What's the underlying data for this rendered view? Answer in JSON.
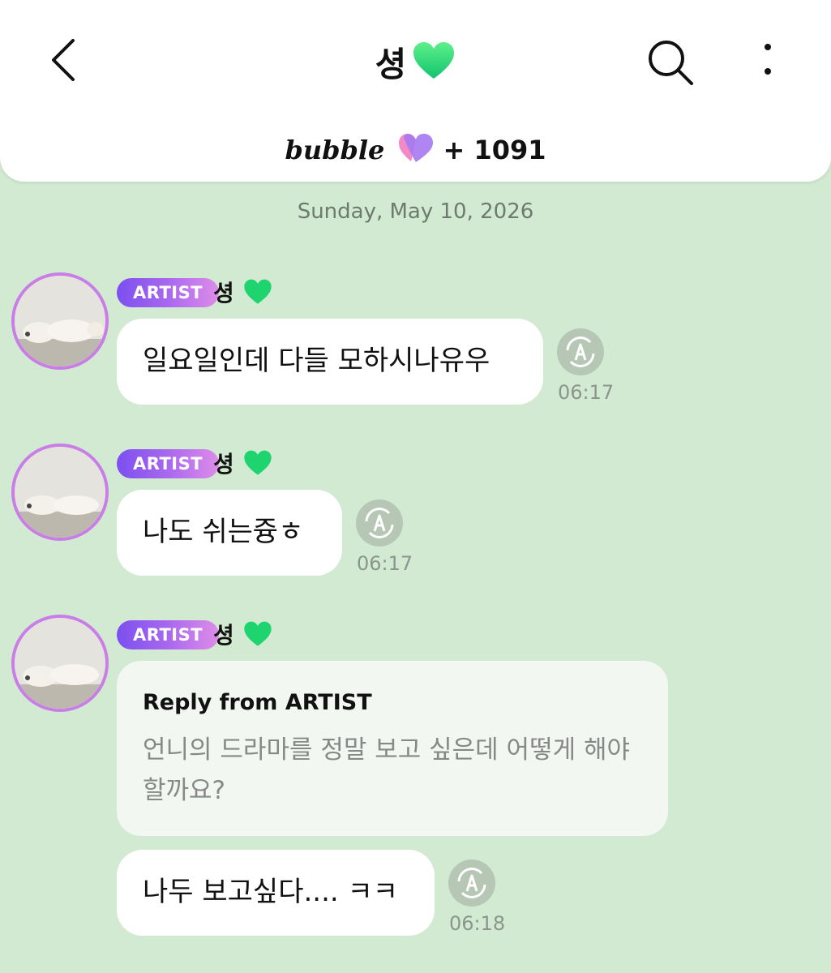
{
  "header": {
    "title": "셩",
    "bubble_logo": "bubble",
    "bubble_count": "+ 1091"
  },
  "chat": {
    "date": "Sunday, May 10, 2026",
    "messages": [
      {
        "badge": "ARTIST",
        "sender": "셩",
        "text": "일요일인데 다들 모하시나유우",
        "time": "06:17"
      },
      {
        "badge": "ARTIST",
        "sender": "셩",
        "text": "나도 쉬는즁ㅎ",
        "time": "06:17"
      },
      {
        "badge": "ARTIST",
        "sender": "셩",
        "reply_title": "Reply from ARTIST",
        "reply_text": "언니의 드라마를 정말 보고 싶은데 어떻게 해야 할까요?",
        "text": "나두 보고싶다.... ㅋㅋ",
        "time": "06:18"
      }
    ]
  },
  "colors": {
    "background": "#d3ead2",
    "header": "#ffffff",
    "badge_gradient": [
      "#7c4ff0",
      "#de8ce9"
    ],
    "green_heart": "#22d46e"
  },
  "icons": [
    "back-chevron-icon",
    "green-heart-icon",
    "search-icon",
    "more-vertical-icon",
    "bubble-heart-icon",
    "translate-icon"
  ]
}
